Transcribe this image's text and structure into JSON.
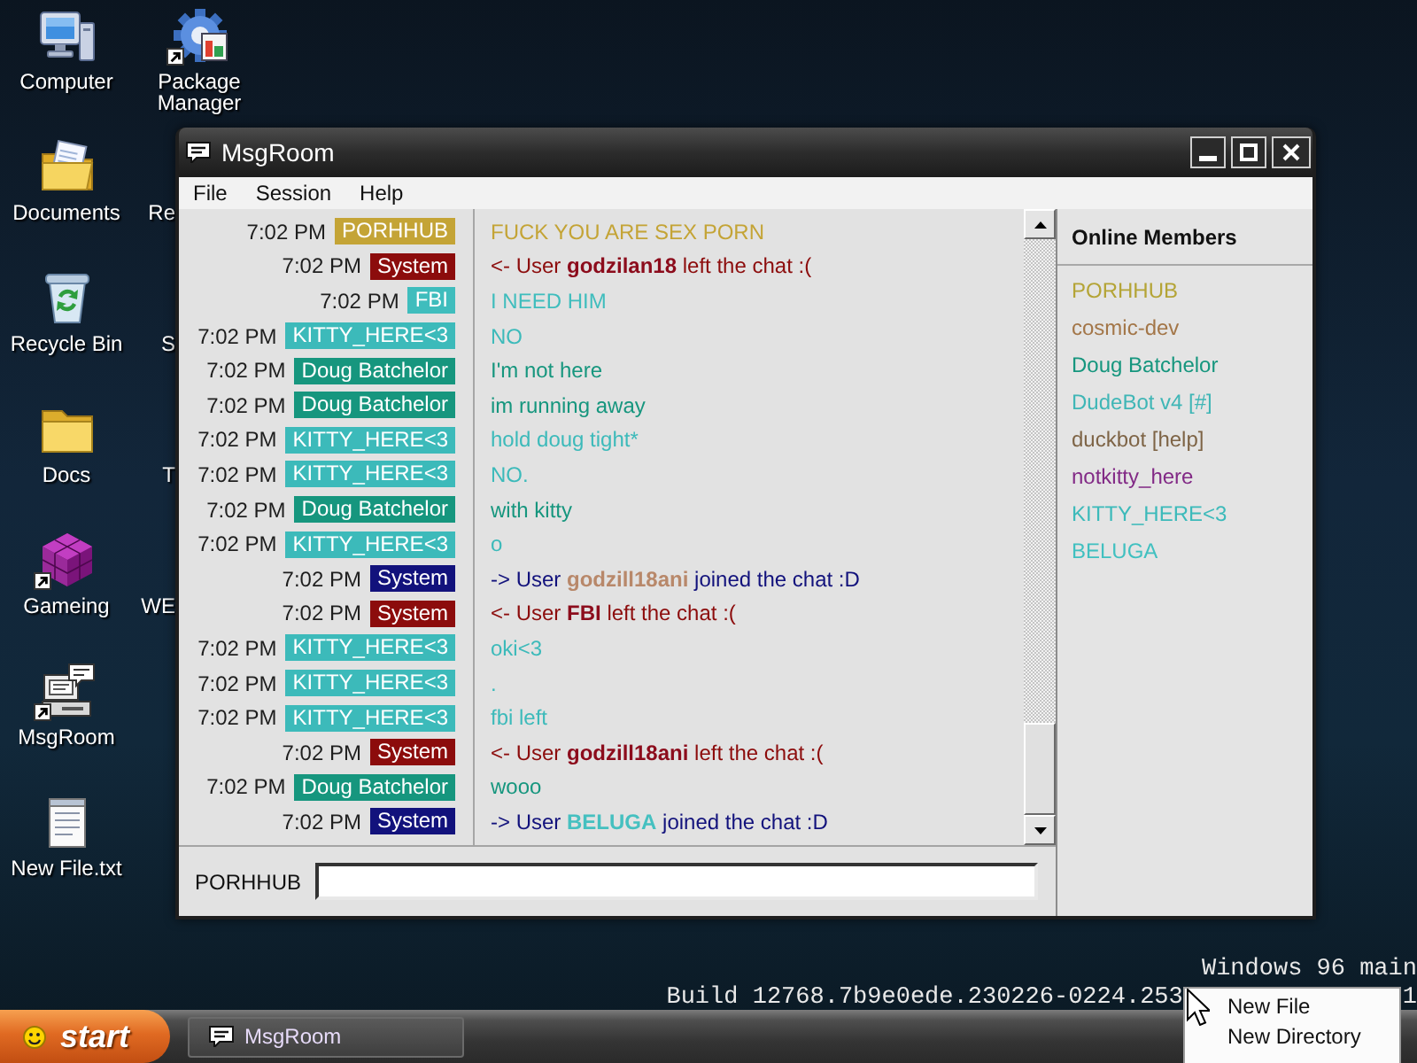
{
  "desktop": {
    "columns": [
      {
        "icons": [
          {
            "kind": "computer",
            "label": "Computer",
            "shortcut": false
          },
          {
            "kind": "documents",
            "label": "Documents",
            "shortcut": false
          },
          {
            "kind": "recycle-bin",
            "label": "Recycle Bin",
            "shortcut": false
          },
          {
            "kind": "folder",
            "label": "Docs",
            "shortcut": false
          },
          {
            "kind": "cube",
            "label": "Gameing",
            "shortcut": true
          },
          {
            "kind": "messenger",
            "label": "MsgRoom",
            "shortcut": true
          },
          {
            "kind": "text-file",
            "label": "New File.txt",
            "shortcut": false
          }
        ]
      },
      {
        "icons": [
          {
            "kind": "package",
            "label": "Package Manager",
            "shortcut": true
          },
          {
            "kind": "hidden",
            "label": "Re"
          },
          {
            "kind": "hidden",
            "label": "S"
          },
          {
            "kind": "hidden",
            "label": "T"
          },
          {
            "kind": "hidden",
            "label": "WE"
          }
        ]
      }
    ],
    "version_text": "Windows 96 main",
    "build_text": [
      "Build 12768.7b9e0ede.230226-0224.253",
      "1"
    ]
  },
  "window": {
    "title": "MsgRoom",
    "menu": [
      {
        "label": "File"
      },
      {
        "label": "Session"
      },
      {
        "label": "Help"
      }
    ],
    "messages": [
      {
        "kind": "message",
        "time": "7:02 PM",
        "user": "PORHHUB",
        "color": "#c4a436",
        "text": "FUCK YOU ARE SEX PORN"
      },
      {
        "kind": "system",
        "time": "7:02 PM",
        "user": "System",
        "color": "#8c0c0c",
        "prefix": "<- User",
        "subject": {
          "name": "godzilan18",
          "color": "#8c0c1c"
        },
        "suffix": "left the chat :("
      },
      {
        "kind": "message",
        "time": "7:02 PM",
        "user": "FBI",
        "color": "#3fbdbd",
        "text": "I NEED HIM"
      },
      {
        "kind": "message",
        "time": "7:02 PM",
        "user": "KITTY_HERE<3",
        "color": "#3cbaba",
        "text": "NO"
      },
      {
        "kind": "message",
        "time": "7:02 PM",
        "user": "Doug Batchelor",
        "color": "#16967e",
        "text": "I'm not here"
      },
      {
        "kind": "message",
        "time": "7:02 PM",
        "user": "Doug Batchelor",
        "color": "#16967e",
        "text": "im running away"
      },
      {
        "kind": "message",
        "time": "7:02 PM",
        "user": "KITTY_HERE<3",
        "color": "#3cbaba",
        "text": "hold doug tight*"
      },
      {
        "kind": "message",
        "time": "7:02 PM",
        "user": "KITTY_HERE<3",
        "color": "#3cbaba",
        "text": "NO."
      },
      {
        "kind": "message",
        "time": "7:02 PM",
        "user": "Doug Batchelor",
        "color": "#16967e",
        "text": "with kitty"
      },
      {
        "kind": "message",
        "time": "7:02 PM",
        "user": "KITTY_HERE<3",
        "color": "#3cbaba",
        "text": "o"
      },
      {
        "kind": "system",
        "time": "7:02 PM",
        "user": "System",
        "color": "#12127c",
        "prefix": "-> User",
        "subject": {
          "name": "godzill18ani",
          "color": "#b8886a"
        },
        "suffix": "joined the chat :D"
      },
      {
        "kind": "system",
        "time": "7:02 PM",
        "user": "System",
        "color": "#8c0c0c",
        "prefix": "<- User",
        "subject": {
          "name": "FBI",
          "color": "#8c0c1c"
        },
        "suffix": "left the chat :("
      },
      {
        "kind": "message",
        "time": "7:02 PM",
        "user": "KITTY_HERE<3",
        "color": "#3cbaba",
        "text": "oki<3"
      },
      {
        "kind": "message",
        "time": "7:02 PM",
        "user": "KITTY_HERE<3",
        "color": "#3cbaba",
        "text": "."
      },
      {
        "kind": "message",
        "time": "7:02 PM",
        "user": "KITTY_HERE<3",
        "color": "#3cbaba",
        "text": "fbi left"
      },
      {
        "kind": "system",
        "time": "7:02 PM",
        "user": "System",
        "color": "#8c0c0c",
        "prefix": "<- User",
        "subject": {
          "name": "godzill18ani",
          "color": "#8c0c1c"
        },
        "suffix": "left the chat :("
      },
      {
        "kind": "message",
        "time": "7:02 PM",
        "user": "Doug Batchelor",
        "color": "#16967e",
        "text": "wooo"
      },
      {
        "kind": "system",
        "time": "7:02 PM",
        "user": "System",
        "color": "#12127c",
        "prefix": "-> User",
        "subject": {
          "name": "BELUGA",
          "color": "#45c0c0"
        },
        "suffix": "joined the chat :D"
      }
    ],
    "members_title": "Online Members",
    "members": [
      {
        "name": "PORHHUB",
        "color": "#b4a436"
      },
      {
        "name": "cosmic-dev",
        "color": "#a37648"
      },
      {
        "name": "Doug Batchelor",
        "color": "#16967e"
      },
      {
        "name": "DudeBot v4 [#]",
        "color": "#3fb6b6"
      },
      {
        "name": "duckbot [help]",
        "color": "#7e6446"
      },
      {
        "name": "notkitty_here",
        "color": "#822a86"
      },
      {
        "name": "KITTY_HERE<3",
        "color": "#3cbaba"
      },
      {
        "name": "BELUGA",
        "color": "#40c0c0"
      }
    ],
    "input": {
      "label": "PORHHUB"
    }
  },
  "context_menu": {
    "items": [
      "New File",
      "New Directory"
    ]
  },
  "taskbar": {
    "start": "start",
    "tasks": [
      {
        "label": "MsgRoom"
      }
    ]
  }
}
